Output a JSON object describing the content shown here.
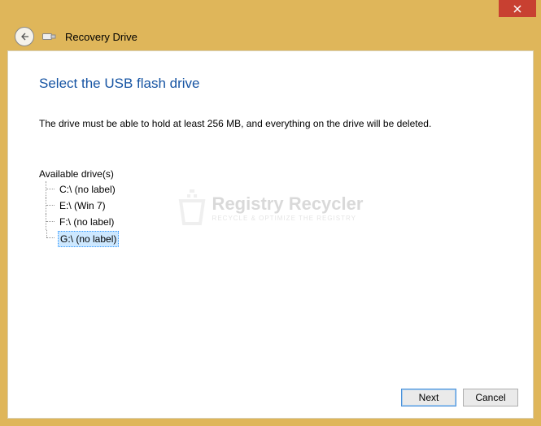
{
  "window": {
    "title": "Recovery Drive"
  },
  "page": {
    "heading": "Select the USB flash drive",
    "instruction": "The drive must be able to hold at least 256 MB, and everything on the drive will be deleted."
  },
  "drives": {
    "label": "Available drive(s)",
    "items": [
      {
        "label": "C:\\ (no label)",
        "selected": false
      },
      {
        "label": "E:\\ (Win 7)",
        "selected": false
      },
      {
        "label": "F:\\ (no label)",
        "selected": false
      },
      {
        "label": "G:\\ (no label)",
        "selected": true
      }
    ]
  },
  "buttons": {
    "next": "Next",
    "cancel": "Cancel"
  },
  "watermark": {
    "title": "Registry Recycler",
    "subtitle": "Recycle & Optimize The Registry"
  }
}
